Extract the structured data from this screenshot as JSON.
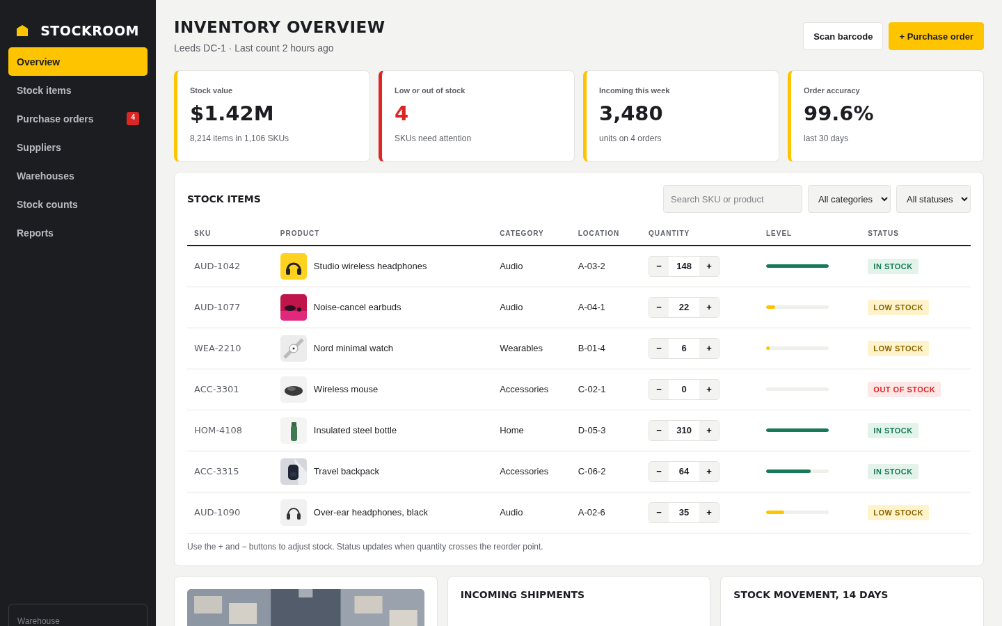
{
  "brand": {
    "name": "STOCKROOM"
  },
  "nav": [
    {
      "label": "Overview",
      "selected": true
    },
    {
      "label": "Stock items",
      "selected": false
    },
    {
      "label": "Purchase orders",
      "selected": false,
      "badge": "4"
    },
    {
      "label": "Suppliers",
      "selected": false
    },
    {
      "label": "Warehouses",
      "selected": false
    },
    {
      "label": "Stock counts",
      "selected": false
    },
    {
      "label": "Reports",
      "selected": false
    }
  ],
  "sidebar_footer": {
    "label": "Warehouse"
  },
  "header": {
    "title": "INVENTORY OVERVIEW",
    "subtitle": "Leeds DC-1 · Last count 2 hours ago",
    "buttons": [
      {
        "label": "Scan barcode",
        "kind": "secondary"
      },
      {
        "label": "+ Purchase order",
        "kind": "primary"
      }
    ]
  },
  "kpis": [
    {
      "label": "Stock value",
      "value": "$1.42M",
      "note": "8,214 items in 1,106 SKUs",
      "color": "#ffc400"
    },
    {
      "label": "Low or out of stock",
      "value": "4",
      "note": "SKUs need attention",
      "color": "#dc2626"
    },
    {
      "label": "Incoming this week",
      "value": "3,480",
      "note": "units on 4 orders",
      "color": "#ffc400"
    },
    {
      "label": "Order accuracy",
      "value": "99.6%",
      "note": "last 30 days",
      "color": "#ffc400"
    }
  ],
  "stock_items": {
    "title": "STOCK ITEMS",
    "search": {
      "placeholder": "Search SKU or product"
    },
    "filters": [
      "All categories",
      "All statuses"
    ],
    "columns": [
      "SKU",
      "PRODUCT",
      "CATEGORY",
      "LOCATION",
      "QUANTITY",
      "LEVEL",
      "STATUS"
    ],
    "rows": [
      {
        "sku": "AUD-1042",
        "product": "Studio wireless headphones",
        "decrement": "−",
        "increment": "+",
        "category": "Audio",
        "location": "A-03-2",
        "quantity": "148",
        "level": 1,
        "status": "IN STOCK",
        "kind": "in"
      },
      {
        "sku": "AUD-1077",
        "product": "Noise-cancel earbuds",
        "decrement": "−",
        "increment": "+",
        "category": "Audio",
        "location": "A-04-1",
        "quantity": "22",
        "level": 0.14,
        "status": "LOW STOCK",
        "kind": "low"
      },
      {
        "sku": "WEA-2210",
        "product": "Nord minimal watch",
        "decrement": "−",
        "increment": "+",
        "category": "Wearables",
        "location": "B-01-4",
        "quantity": "6",
        "level": 0.06,
        "status": "LOW STOCK",
        "kind": "low"
      },
      {
        "sku": "ACC-3301",
        "product": "Wireless mouse",
        "decrement": "−",
        "increment": "+",
        "category": "Accessories",
        "location": "C-02-1",
        "quantity": "0",
        "level": 0,
        "status": "OUT OF STOCK",
        "kind": "out"
      },
      {
        "sku": "HOM-4108",
        "product": "Insulated steel bottle",
        "decrement": "−",
        "increment": "+",
        "category": "Home",
        "location": "D-05-3",
        "quantity": "310",
        "level": 1,
        "status": "IN STOCK",
        "kind": "in"
      },
      {
        "sku": "ACC-3315",
        "product": "Travel backpack",
        "decrement": "−",
        "increment": "+",
        "category": "Accessories",
        "location": "C-06-2",
        "quantity": "64",
        "level": 0.71,
        "status": "IN STOCK",
        "kind": "in"
      },
      {
        "sku": "AUD-1090",
        "product": "Over-ear headphones, black",
        "decrement": "−",
        "increment": "+",
        "category": "Audio",
        "location": "A-02-6",
        "quantity": "35",
        "level": 0.29,
        "status": "LOW STOCK",
        "kind": "low"
      }
    ],
    "footnote": "Use the + and − buttons to adjust stock. Status updates when quantity crosses the reorder point."
  },
  "bottom_cards": [
    {
      "kind": "picture"
    },
    {
      "kind": "panel",
      "title": "INCOMING SHIPMENTS"
    },
    {
      "kind": "panel",
      "title": "STOCK MOVEMENT, 14 DAYS"
    }
  ]
}
